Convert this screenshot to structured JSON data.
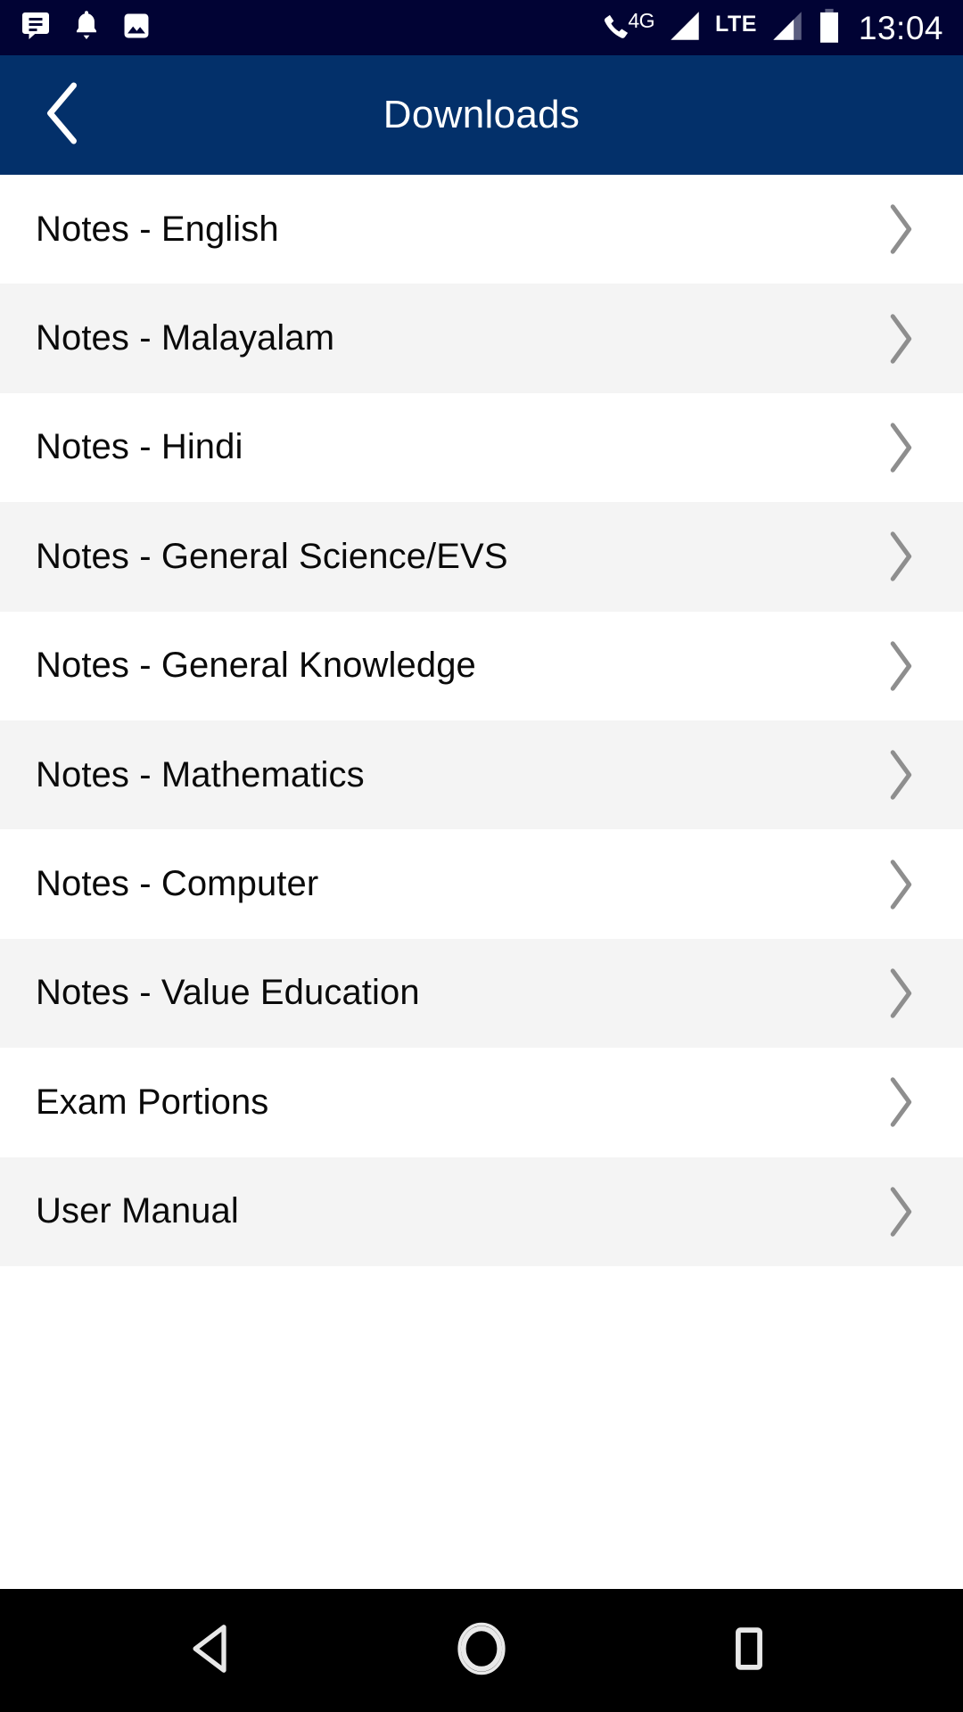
{
  "status_bar": {
    "background_color": "#010334",
    "foreground_color": "#ffffff",
    "time": "13:04",
    "left_icons": [
      {
        "name": "message-icon",
        "label": "Messages"
      },
      {
        "name": "notification-bell-icon",
        "label": "Notifications"
      },
      {
        "name": "image-icon",
        "label": "Screenshot"
      }
    ],
    "right_icons": [
      {
        "name": "phone-call-icon",
        "label": "Call"
      },
      {
        "name": "network-type-4g-label",
        "label": "4G"
      },
      {
        "name": "signal-bars-sim1-icon",
        "label": "Signal SIM 1"
      },
      {
        "name": "network-type-lte-label",
        "label": "LTE"
      },
      {
        "name": "signal-bars-sim2-icon",
        "label": "Signal SIM 2"
      },
      {
        "name": "battery-icon",
        "label": "Battery"
      }
    ]
  },
  "app_bar": {
    "background_color": "#03306A",
    "title": "Downloads",
    "back_icon": "chevron-left-icon"
  },
  "list": {
    "row_chevron_icon": "chevron-right-icon",
    "row_bg_odd": "#ffffff",
    "row_bg_even": "#f4f4f4",
    "items": [
      {
        "label": "Notes - English"
      },
      {
        "label": "Notes - Malayalam"
      },
      {
        "label": "Notes - Hindi"
      },
      {
        "label": "Notes - General Science/EVS"
      },
      {
        "label": "Notes - General Knowledge"
      },
      {
        "label": "Notes - Mathematics"
      },
      {
        "label": "Notes - Computer"
      },
      {
        "label": "Notes - Value Education"
      },
      {
        "label": "Exam Portions"
      },
      {
        "label": "User Manual"
      }
    ]
  },
  "nav_bar": {
    "background_color": "#000000",
    "buttons": [
      {
        "name": "nav-back-button",
        "icon": "triangle-left-icon",
        "label": "Back"
      },
      {
        "name": "nav-home-button",
        "icon": "circle-icon",
        "label": "Home"
      },
      {
        "name": "nav-recents-button",
        "icon": "square-icon",
        "label": "Recents"
      }
    ]
  }
}
